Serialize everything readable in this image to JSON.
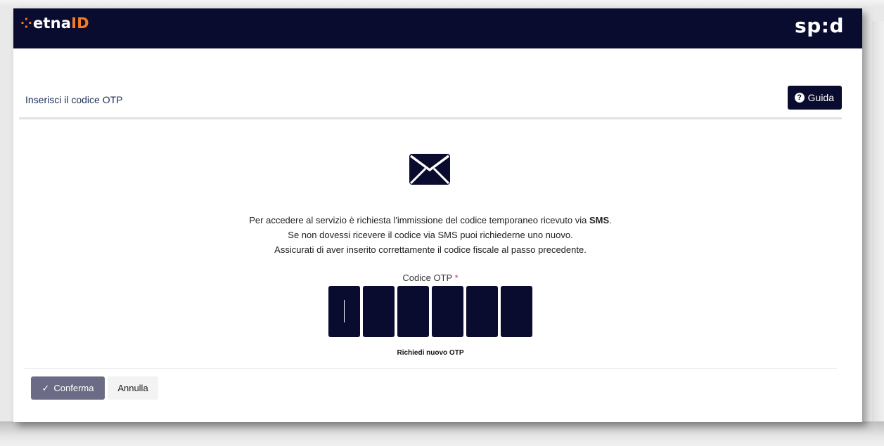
{
  "header": {
    "brand_prefix": "etna",
    "brand_suffix": "ID",
    "spid_logo": "sp:d",
    "colors": {
      "bar": "#0a0c2f",
      "brand_accent": "#f47c20"
    }
  },
  "page": {
    "title": "Inserisci il codice OTP",
    "help_button": "Guida",
    "help_icon": "question-circle-icon"
  },
  "content": {
    "icon": "envelope-icon",
    "message_line1_prefix": "Per accedere al servizio è richiesta l'immissione del codice temporaneo ricevuto via ",
    "message_line1_bold": "SMS",
    "message_line1_suffix": ".",
    "message_line2": "Se non dovessi ricevere il codice via SMS puoi richiederne uno nuovo.",
    "message_line3": "Assicurati di aver inserito correttamente il codice fiscale al passo precedente.",
    "otp_label": "Codice OTP",
    "required_mark": "*",
    "otp_digits": [
      "",
      "",
      "",
      "",
      "",
      ""
    ],
    "resend_link": "Richiedi nuovo OTP"
  },
  "footer": {
    "confirm_button": "Conferma",
    "confirm_icon": "check-icon",
    "cancel_button": "Annulla",
    "colors": {
      "confirm": "#6b6b85"
    }
  }
}
